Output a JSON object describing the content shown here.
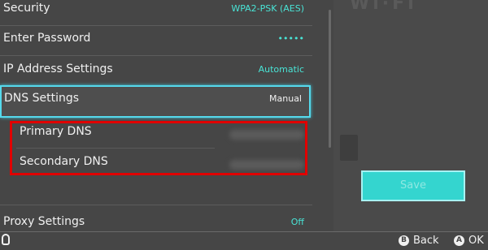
{
  "settings": {
    "security": {
      "label": "Security",
      "value": "WPA2-PSK (AES)"
    },
    "password": {
      "label": "Enter Password",
      "value": "•••••"
    },
    "ip": {
      "label": "IP Address Settings",
      "value": "Automatic"
    },
    "dns": {
      "label": "DNS Settings",
      "value": "Manual"
    },
    "primary_dns": {
      "label": "Primary DNS"
    },
    "secondary_dns": {
      "label": "Secondary DNS"
    },
    "proxy": {
      "label": "Proxy Settings",
      "value": "Off"
    }
  },
  "save_label": "Save",
  "footer": {
    "back_key": "B",
    "back_label": "Back",
    "ok_key": "A",
    "ok_label": "OK"
  },
  "colors": {
    "accent": "#49e4d6",
    "highlight": "#e00000",
    "save": "#34d5cf"
  },
  "icons": [
    "hand-icon",
    "b-button-icon",
    "a-button-icon"
  ]
}
